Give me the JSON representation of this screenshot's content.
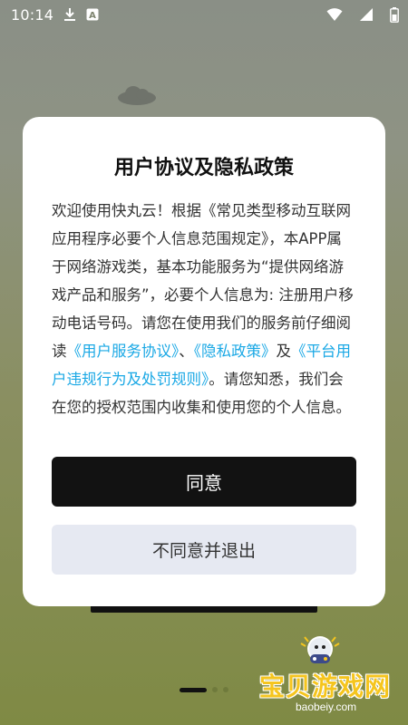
{
  "status_bar": {
    "time": "10:14",
    "icons": [
      "download-icon",
      "a-notification-icon",
      "wifi-icon",
      "signal-icon",
      "battery-icon"
    ]
  },
  "dialog": {
    "title": "用户协议及隐私政策",
    "body": {
      "part1": "欢迎使用快丸云！根据《常见类型移动互联网应用程序必要个人信息范围规定》，本APP属于网络游戏类，基本功能服务为“提供网络游戏产品和服务”，必要个人信息为: 注册用户移动电话号码。请您在使用我们的服务前仔细阅读",
      "link_user_agreement": "《用户服务协议》",
      "sep1": "、",
      "link_privacy": "《隐私政策》",
      "sep2": "及",
      "link_rules": "《平台用户违规行为及处罚规则》",
      "part2": "。请您知悉，我们会在您的授权范围内收集和使用您的个人信息。"
    },
    "agree_label": "同意",
    "disagree_label": "不同意并退出"
  },
  "watermark": {
    "main": "宝贝游戏网",
    "sub": "baobeiy.com"
  },
  "colors": {
    "link": "#1aa8e5",
    "agree_bg": "#121212",
    "disagree_bg": "#e6e9f2",
    "watermark": "#f5c51e"
  }
}
